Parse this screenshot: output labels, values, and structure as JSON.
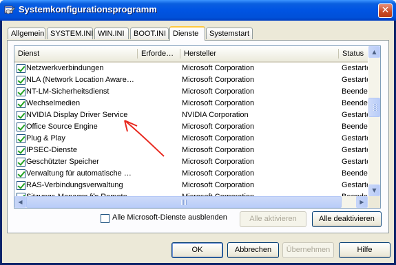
{
  "window": {
    "title": "Systemkonfigurationsprogramm",
    "close_glyph": "✕"
  },
  "tabs": [
    {
      "label": "Allgemein"
    },
    {
      "label": "SYSTEM.INI"
    },
    {
      "label": "WIN.INI"
    },
    {
      "label": "BOOT.INI"
    },
    {
      "label": "Dienste",
      "active": true
    },
    {
      "label": "Systemstart"
    }
  ],
  "list": {
    "columns": [
      "Dienst",
      "Erforde…",
      "Hersteller",
      "Status"
    ],
    "rows": [
      {
        "name": "Netzwerkverbindungen",
        "vendor": "Microsoft Corporation",
        "status": "Gestartet",
        "checked": true
      },
      {
        "name": "NLA (Network Location Aware…",
        "vendor": "Microsoft Corporation",
        "status": "Gestartet",
        "checked": true
      },
      {
        "name": "NT-LM-Sicherheitsdienst",
        "vendor": "Microsoft Corporation",
        "status": "Beendet",
        "checked": true
      },
      {
        "name": "Wechselmedien",
        "vendor": "Microsoft Corporation",
        "status": "Beendet",
        "checked": true
      },
      {
        "name": "NVIDIA Display Driver Service",
        "vendor": "NVIDIA Corporation",
        "status": "Gestartet",
        "checked": true
      },
      {
        "name": "Office Source Engine",
        "vendor": "Microsoft Corporation",
        "status": "Beendet",
        "checked": true
      },
      {
        "name": "Plug & Play",
        "vendor": "Microsoft Corporation",
        "status": "Gestartet",
        "checked": true
      },
      {
        "name": "IPSEC-Dienste",
        "vendor": "Microsoft Corporation",
        "status": "Gestartet",
        "checked": true
      },
      {
        "name": "Geschützter Speicher",
        "vendor": "Microsoft Corporation",
        "status": "Gestartet",
        "checked": true
      },
      {
        "name": "Verwaltung für automatische …",
        "vendor": "Microsoft Corporation",
        "status": "Beendet",
        "checked": true
      },
      {
        "name": "RAS-Verbindungsverwaltung",
        "vendor": "Microsoft Corporation",
        "status": "Gestartet",
        "checked": true
      },
      {
        "name": "Sitzungs-Manager für Remote…",
        "vendor": "Microsoft Corporation",
        "status": "Beendet",
        "checked": true
      }
    ]
  },
  "options": {
    "hide_ms_label": "Alle Microsoft-Dienste ausblenden",
    "enable_all_label": "Alle aktivieren",
    "disable_all_label": "Alle deaktivieren"
  },
  "footer": {
    "ok_label": "OK",
    "cancel_label": "Abbrechen",
    "apply_label": "Übernehmen",
    "help_label": "Hilfe"
  },
  "scroll": {
    "up_glyph": "▲",
    "down_glyph": "▼",
    "left_glyph": "◀",
    "right_glyph": "▶"
  },
  "colors": {
    "annotation_arrow": "#e8281e",
    "check_mark": "#21a121",
    "tab_highlight": "#ffc83c"
  }
}
